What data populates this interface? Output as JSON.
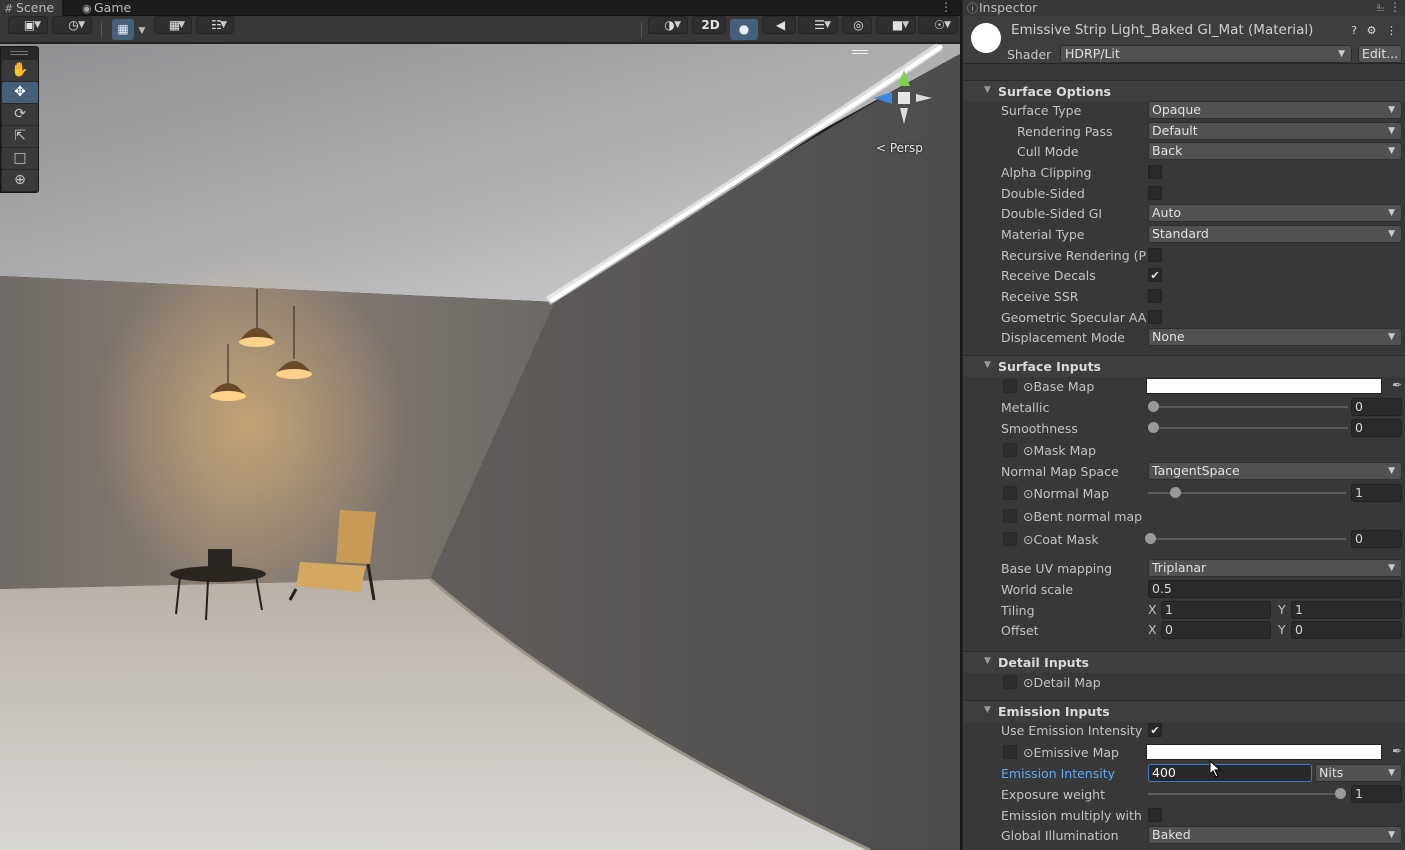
{
  "scene": {
    "tabs": [
      {
        "label": "Scene",
        "icon": "grid-icon"
      },
      {
        "label": "Game",
        "icon": "gamepad-icon"
      }
    ],
    "toolbar": {
      "toggle_2d": "2D"
    },
    "gizmo_label": "< Persp",
    "tools": [
      "hand-tool",
      "move-tool",
      "rotate-tool",
      "scale-tool",
      "rect-tool",
      "transform-tool"
    ]
  },
  "inspector": {
    "tab_label": "Inspector",
    "material_title": "Emissive Strip Light_Baked GI_Mat (Material)",
    "shader_label": "Shader",
    "shader_value": "HDRP/Lit",
    "edit_label": "Edit...",
    "sections": {
      "surface_options": {
        "title": "Surface Options",
        "surface_type": {
          "label": "Surface Type",
          "value": "Opaque"
        },
        "rendering_pass": {
          "label": "Rendering Pass",
          "value": "Default"
        },
        "cull_mode": {
          "label": "Cull Mode",
          "value": "Back"
        },
        "alpha_clipping": {
          "label": "Alpha Clipping",
          "checked": false
        },
        "double_sided": {
          "label": "Double-Sided",
          "checked": false
        },
        "double_sided_gi": {
          "label": "Double-Sided GI",
          "value": "Auto"
        },
        "material_type": {
          "label": "Material Type",
          "value": "Standard"
        },
        "recursive_rendering": {
          "label": "Recursive Rendering (Pi",
          "checked": false
        },
        "receive_decals": {
          "label": "Receive Decals",
          "checked": true
        },
        "receive_ssr": {
          "label": "Receive SSR",
          "checked": false
        },
        "geometric_specular_aa": {
          "label": "Geometric Specular AA",
          "checked": false
        },
        "displacement_mode": {
          "label": "Displacement Mode",
          "value": "None"
        }
      },
      "surface_inputs": {
        "title": "Surface Inputs",
        "base_map": {
          "label": "⊙Base Map"
        },
        "metallic": {
          "label": "Metallic",
          "value": "0",
          "fraction": 0
        },
        "smoothness": {
          "label": "Smoothness",
          "value": "0",
          "fraction": 0
        },
        "mask_map": {
          "label": "⊙Mask Map"
        },
        "normal_map_space": {
          "label": "Normal Map Space",
          "value": "TangentSpace"
        },
        "normal_map": {
          "label": "⊙Normal Map",
          "value": "1",
          "fraction": 0.1
        },
        "bent_normal_map": {
          "label": "⊙Bent normal map"
        },
        "coat_mask": {
          "label": "⊙Coat Mask",
          "value": "0",
          "fraction": 0
        },
        "base_uv_mapping": {
          "label": "Base UV mapping",
          "value": "Triplanar"
        },
        "world_scale": {
          "label": "World scale",
          "value": "0.5"
        },
        "tiling": {
          "label": "Tiling",
          "x_label": "X",
          "x": "1",
          "y_label": "Y",
          "y": "1"
        },
        "offset": {
          "label": "Offset",
          "x_label": "X",
          "x": "0",
          "y_label": "Y",
          "y": "0"
        }
      },
      "detail_inputs": {
        "title": "Detail Inputs",
        "detail_map": {
          "label": "⊙Detail Map"
        }
      },
      "emission_inputs": {
        "title": "Emission Inputs",
        "use_emission_intensity": {
          "label": "Use Emission Intensity",
          "checked": true
        },
        "emissive_map": {
          "label": "⊙Emissive Map"
        },
        "emission_intensity": {
          "label": "Emission Intensity",
          "value": "400",
          "unit": "Nits"
        },
        "exposure_weight": {
          "label": "Exposure weight",
          "value": "1",
          "fraction": 1
        },
        "emission_multiply": {
          "label": "Emission multiply with B",
          "checked": false
        },
        "global_illumination": {
          "label": "Global Illumination",
          "value": "Baked"
        }
      }
    }
  },
  "colors": {
    "accent": "#46607c",
    "label_highlight": "#5fa9f5",
    "focus_border": "#3a7ad0"
  }
}
